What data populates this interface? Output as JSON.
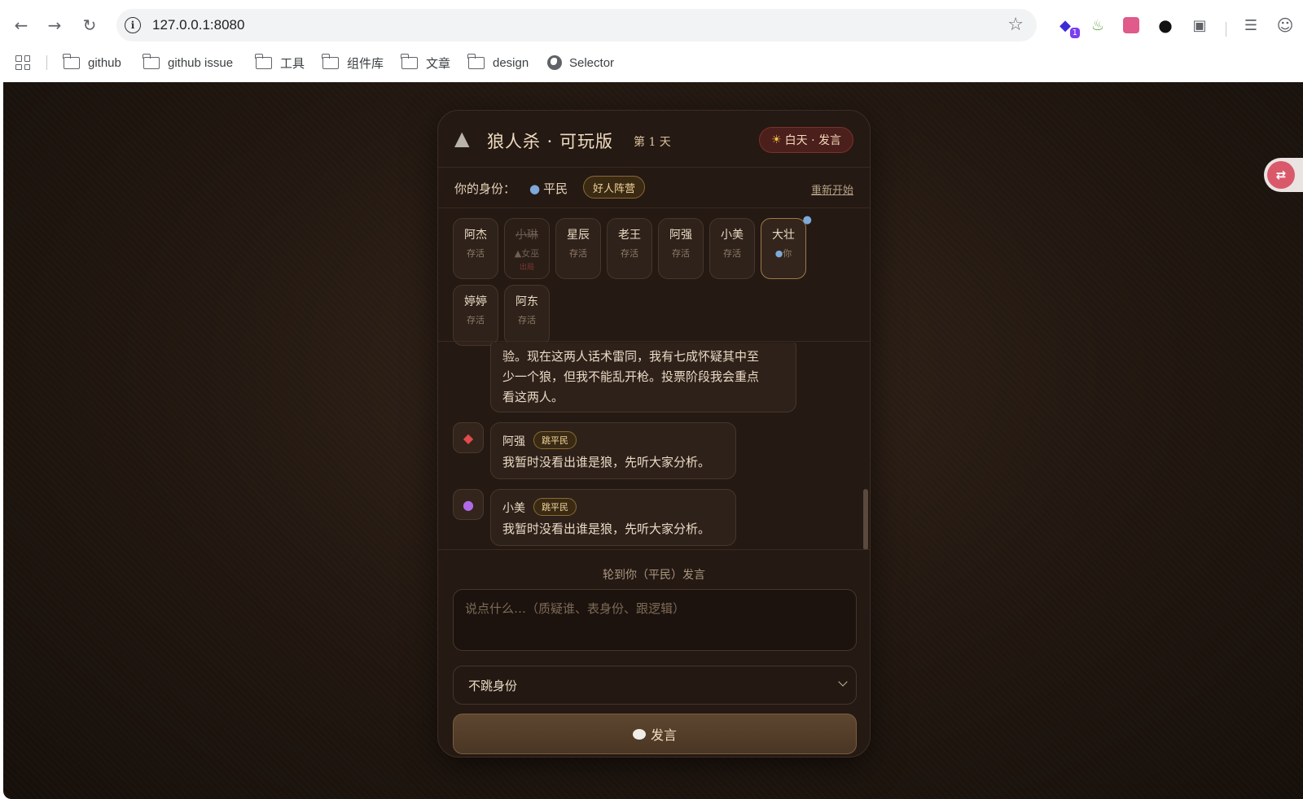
{
  "browser": {
    "url": "127.0.0.1:8080",
    "ext_badge": "1",
    "bookmarks": [
      {
        "label": "github"
      },
      {
        "label": "github issue"
      },
      {
        "label": "工具"
      },
      {
        "label": "组件库"
      },
      {
        "label": "文章"
      },
      {
        "label": "design"
      },
      {
        "label": "Selector"
      }
    ]
  },
  "game": {
    "title": "狼人杀 · 可玩版",
    "day": "第 1 天",
    "phase": "白天 · 发言",
    "identity_label": "你的身份：",
    "role": "平民",
    "camp": "好人阵营",
    "restart": "重新开始",
    "players": [
      {
        "name": "阿杰",
        "status": "存活"
      },
      {
        "name": "小琳",
        "status": "女巫",
        "note": "出局"
      },
      {
        "name": "星辰",
        "status": "存活"
      },
      {
        "name": "老王",
        "status": "存活"
      },
      {
        "name": "阿强",
        "status": "存活"
      },
      {
        "name": "小美",
        "status": "存活"
      },
      {
        "name": "大壮",
        "status": "你"
      },
      {
        "name": "婷婷",
        "status": "存活"
      },
      {
        "name": "阿东",
        "status": "存活"
      }
    ],
    "chat": {
      "partial_lines": [
        "验。现在这两人话术雷同，我有七成怀疑其中至",
        "少一个狼，但我不能乱开枪。投票阶段我会重点",
        "看这两人。"
      ],
      "messages": [
        {
          "speaker": "阿强",
          "claim": "跳平民",
          "text": "我暂时没看出谁是狼，先听大家分析。",
          "avatar": "shield-icon"
        },
        {
          "speaker": "小美",
          "claim": "跳平民",
          "text": "我暂时没看出谁是狼，先听大家分析。",
          "avatar": "crystal-ball-icon"
        }
      ]
    },
    "turn_hint": "轮到你（平民）发言",
    "input_placeholder": "说点什么…（质疑谁、表身份、跟逻辑）",
    "claim_select_value": "不跳身份",
    "speak_button": "发言"
  },
  "colors": {
    "background": "#211710",
    "panel": "#241913",
    "accent_gold": "#f0d49a",
    "phase_badge": "#4b1f1c"
  }
}
